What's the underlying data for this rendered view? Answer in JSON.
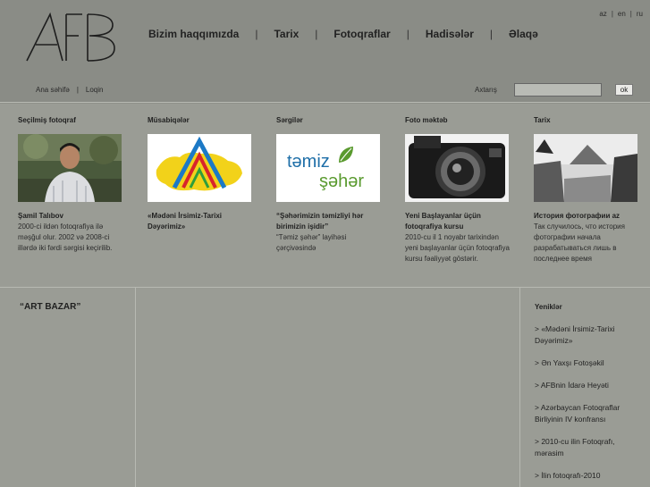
{
  "logo": {
    "text": "AFB"
  },
  "nav": [
    {
      "label": "Bizim haqqımızda"
    },
    {
      "label": "Tarix"
    },
    {
      "label": "Fotoqraflar"
    },
    {
      "label": "Hadisələr"
    },
    {
      "label": "Əlaqə"
    }
  ],
  "lang": [
    "az",
    "en",
    "ru"
  ],
  "breadcrumb": {
    "home": "Ana səhifə",
    "login": "Loqin"
  },
  "search": {
    "label": "Axtarış",
    "value": "",
    "button": "ok"
  },
  "features": [
    {
      "title": "Seçilmiş fotoqraf",
      "caption_title": "Şamil Talıbov",
      "caption_text": "2000-ci ildən fotoqrafiya ilə məşğul olur. 2002 və 2008-ci illərdə iki fərdi sərgisi keçirilib."
    },
    {
      "title": "Müsabiqələr",
      "caption_title": "«Mədəni İrsimiz-Tarixi Dəyərimiz»",
      "caption_text": ""
    },
    {
      "title": "Sərgilər",
      "caption_title": "“Şəhərimizin təmizliyi hər birimizin işidir”",
      "caption_text": "“Təmiz şəhər” layihəsi çərçivəsində",
      "image_text_1": "təmiz",
      "image_text_2": "şəhər"
    },
    {
      "title": "Foto məktəb",
      "caption_title": "Yeni Başlayanlar üçün fotoqrafiya kursu",
      "caption_text": "2010-cu il 1 noyabr tarixindən yeni başlayanlar üçün fotoqrafiya kursu fəaliyyət göstərir."
    },
    {
      "title": "Tarix",
      "caption_title": "История фотографии az",
      "caption_text": "Так случилось, что история фотографии начала разрабатываться лишь в последнее время"
    }
  ],
  "art_bazar": "“ART BAZAR”",
  "news": {
    "title": "Yeniklər",
    "items": [
      "> «Mədəni İrsimiz-Tarixi Dəyərimiz»",
      "> Ən Yaxşı Fotoşəkil",
      "> AFBnin İdarə Heyəti",
      "> Azərbaycan Fotoqraflar Birliyinin IV konfransı",
      "> 2010-cu ilin Fotoqrafı, mərasim",
      "> İlin fotoqrafı-2010"
    ]
  },
  "colors": {
    "header_bg": "#8a8c86",
    "content_bg": "#9a9c95",
    "divider": "#b7b9b2",
    "tamiz_blue": "#1f6fa8",
    "tamiz_green": "#5a9a2f"
  }
}
